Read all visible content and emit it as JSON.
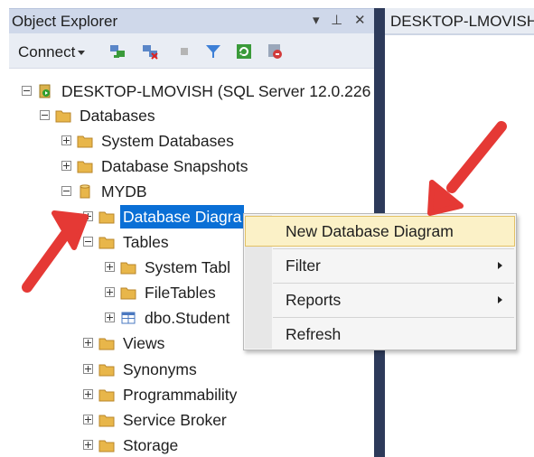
{
  "explorer": {
    "title": "Object Explorer",
    "pin_glyph": "▾ ⊥",
    "close_glyph": "✕"
  },
  "toolbar": {
    "connect_label": "Connect"
  },
  "right_panel": {
    "tab_label": "DESKTOP-LMOVISH"
  },
  "tree": {
    "server": "DESKTOP-LMOVISH (SQL Server 12.0.226",
    "databases": "Databases",
    "system_databases": "System Databases",
    "database_snapshots": "Database Snapshots",
    "mydb": "MYDB",
    "database_diagrams": "Database Diagra",
    "tables": "Tables",
    "system_tables": "System Tabl",
    "file_tables": "FileTables",
    "dbo_student": "dbo.Student",
    "views": "Views",
    "synonyms": "Synonyms",
    "programmability": "Programmability",
    "service_broker": "Service Broker",
    "storage": "Storage"
  },
  "context_menu": {
    "items": [
      {
        "label": "New Database Diagram",
        "highlighted": true,
        "submenu": false
      },
      {
        "label": "Filter",
        "highlighted": false,
        "submenu": true
      },
      {
        "label": "Reports",
        "highlighted": false,
        "submenu": true
      },
      {
        "label": "Refresh",
        "highlighted": false,
        "submenu": false
      }
    ]
  },
  "colors": {
    "selection": "#0a6fd6",
    "menu_highlight": "#fbf1c7",
    "annotation_arrow": "#e53935",
    "folder": "#e8b64a"
  }
}
